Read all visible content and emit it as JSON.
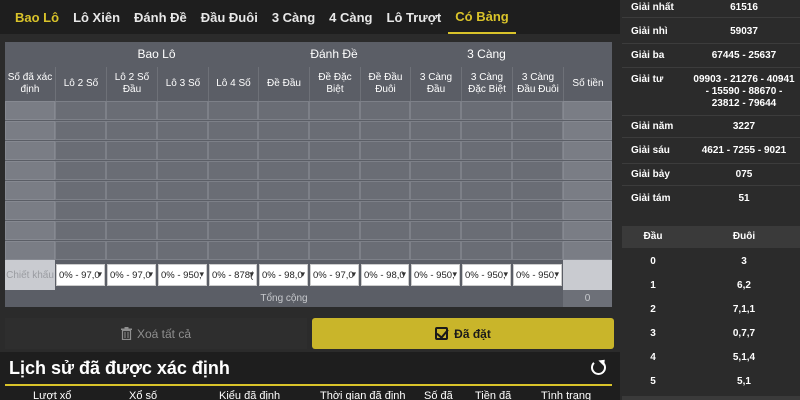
{
  "tabs": [
    {
      "label": "Bao Lô"
    },
    {
      "label": "Lô Xiên"
    },
    {
      "label": "Đánh Đề"
    },
    {
      "label": "Đầu Đuôi"
    },
    {
      "label": "3 Càng"
    },
    {
      "label": "4 Càng"
    },
    {
      "label": "Lô Trượt"
    },
    {
      "label": "Có Bảng"
    }
  ],
  "table": {
    "groups": [
      "Bao Lô",
      "Đánh Đề",
      "3 Càng"
    ],
    "columns": [
      "Số đã xác định",
      "Lô 2 Số",
      "Lô 2 Số Đầu",
      "Lô 3 Số",
      "Lô 4 Số",
      "Đề Đầu",
      "Đề Đặc Biệt",
      "Đề Đầu Đuôi",
      "3 Càng Đầu",
      "3 Càng Đặc Biệt",
      "3 Càng Đầu Đuôi",
      "Số tiền"
    ],
    "chiet_khau_label": "Chiết khấu",
    "chiet_khau": [
      "0% - 97,0",
      "0% - 97,0",
      "0% - 950,",
      "0% - 878(",
      "0% - 98,0",
      "0% - 97,0",
      "0% - 98,0",
      "0% - 950,",
      "0% - 950,",
      "0% - 950,"
    ],
    "total_label": "Tổng cộng",
    "total_value": "0"
  },
  "buttons": {
    "clear_label": "Xoá tất cả",
    "done_label": "Đã đặt"
  },
  "history": {
    "title": "Lịch sử đã được xác định",
    "columns": [
      "Lượt xổ",
      "Xổ số",
      "Kiểu đã định",
      "Thời gian đã định",
      "Số đã",
      "Tiền đã",
      "Tình trạng"
    ]
  },
  "results": [
    {
      "label": "Giải nhất",
      "value": "61516"
    },
    {
      "label": "Giải nhì",
      "value": "59037"
    },
    {
      "label": "Giải ba",
      "value": "67445 - 25637"
    },
    {
      "label": "Giải tư",
      "value": "09903 - 21276 - 40941 - 15590 - 88670 - 23812 - 79644"
    },
    {
      "label": "Giải năm",
      "value": "3227"
    },
    {
      "label": "Giải sáu",
      "value": "4621 - 7255 - 9021"
    },
    {
      "label": "Giải bảy",
      "value": "075"
    },
    {
      "label": "Giải tám",
      "value": "51"
    }
  ],
  "dau_duoi": {
    "head_dau": "Đầu",
    "head_duoi": "Đuôi",
    "rows": [
      {
        "dau": "0",
        "duoi": "3"
      },
      {
        "dau": "1",
        "duoi": "6,2"
      },
      {
        "dau": "2",
        "duoi": "7,1,1"
      },
      {
        "dau": "3",
        "duoi": "0,7,7"
      },
      {
        "dau": "4",
        "duoi": "5,1,4"
      },
      {
        "dau": "5",
        "duoi": "5,1"
      }
    ]
  },
  "colors": {
    "accent": "#d9c32a",
    "button_done": "#c9b52a",
    "table_bg": "#5b5e66"
  }
}
